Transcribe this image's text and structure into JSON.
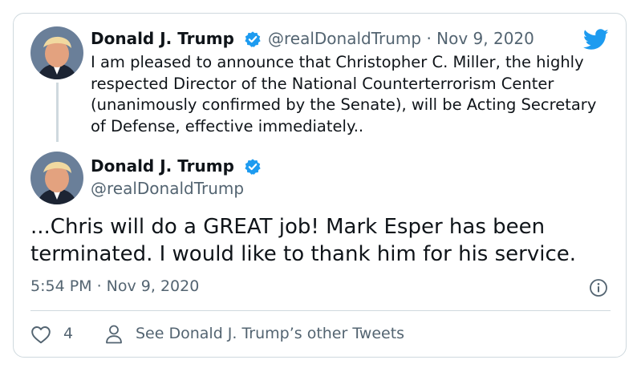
{
  "quoted_tweet": {
    "author_name": "Donald J. Trump",
    "handle": "@realDonaldTrump",
    "separator": "·",
    "date": "Nov 9, 2020",
    "text": "I am pleased to announce that Christopher C. Miller, the highly respected Director of the National Counterterrorism Center (unanimously confirmed by the Senate), will be Acting Secretary of Defense, effective immediately.."
  },
  "main_tweet": {
    "author_name": "Donald J. Trump",
    "handle": "@realDonaldTrump",
    "text": "...Chris will do a GREAT job! Mark Esper has been terminated. I would like to thank him for his service.",
    "timestamp": "5:54 PM · Nov 9, 2020"
  },
  "footer": {
    "like_count": "4",
    "profile_link": "See Donald J. Trump’s other Tweets"
  },
  "icons": {
    "brand": "twitter-bird-icon",
    "verified": "verified-badge-icon",
    "info": "info-icon",
    "like": "heart-icon",
    "profile": "person-icon"
  },
  "colors": {
    "brand_blue": "#1d9bf0",
    "text_primary": "#0f1419",
    "text_secondary": "#536471",
    "border": "#cfd9de"
  }
}
